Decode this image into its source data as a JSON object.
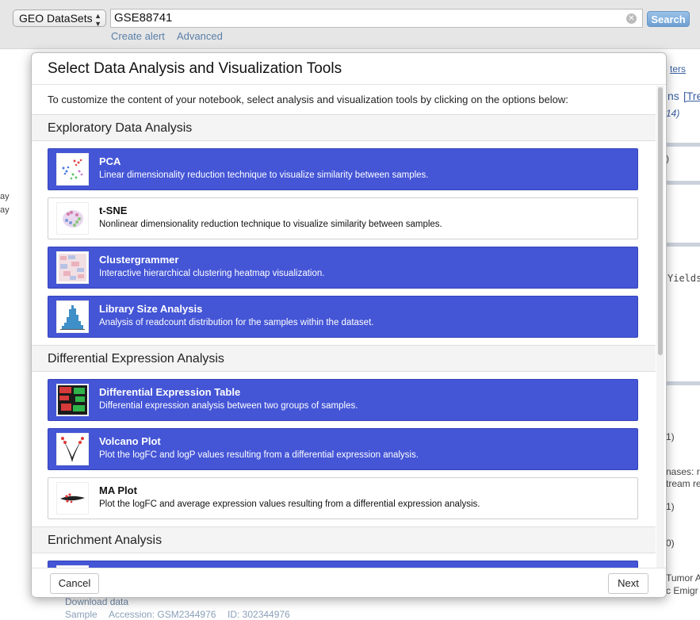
{
  "topbar": {
    "database": "GEO DataSets",
    "query": "GSE88741",
    "search_label": "Search",
    "links": [
      "Create alert",
      "Advanced"
    ]
  },
  "background": {
    "right": [
      "ters",
      "ns",
      "[Tre",
      "14)",
      "Yields",
      ")",
      "nases: r",
      "tream re",
      "1)",
      "0)",
      "Tumor A",
      "c Emigr"
    ],
    "left": [
      "ay",
      "ay"
    ],
    "bottom": [
      "Download data",
      "Sample",
      "Accession: GSM2344976",
      "ID: 302344976"
    ]
  },
  "modal": {
    "title": "Select Data Analysis and Visualization Tools",
    "intro": "To customize the content of your notebook, select analysis and visualization tools by clicking on the options below:",
    "sections": [
      {
        "title": "Exploratory Data Analysis",
        "tools": [
          {
            "name": "PCA",
            "description": "Linear dimensionality reduction technique to visualize similarity between samples.",
            "selected": true
          },
          {
            "name": "t-SNE",
            "description": "Nonlinear dimensionality reduction technique to visualize similarity between samples.",
            "selected": false
          },
          {
            "name": "Clustergrammer",
            "description": "Interactive hierarchical clustering heatmap visualization.",
            "selected": true
          },
          {
            "name": "Library Size Analysis",
            "description": "Analysis of readcount distribution for the samples within the dataset.",
            "selected": true
          }
        ]
      },
      {
        "title": "Differential Expression Analysis",
        "tools": [
          {
            "name": "Differential Expression Table",
            "description": "Differential expression analysis between two groups of samples.",
            "selected": true
          },
          {
            "name": "Volcano Plot",
            "description": "Plot the logFC and logP values resulting from a differential expression analysis.",
            "selected": true
          },
          {
            "name": "MA Plot",
            "description": "Plot the logFC and average expression values resulting from a differential expression analysis.",
            "selected": false
          }
        ]
      },
      {
        "title": "Enrichment Analysis",
        "tools": []
      }
    ],
    "cancel_label": "Cancel",
    "next_label": "Next"
  },
  "colors": {
    "selected_card": "#4455d6",
    "link": "#5a7fa8",
    "search_button": "#6d9fd2"
  }
}
